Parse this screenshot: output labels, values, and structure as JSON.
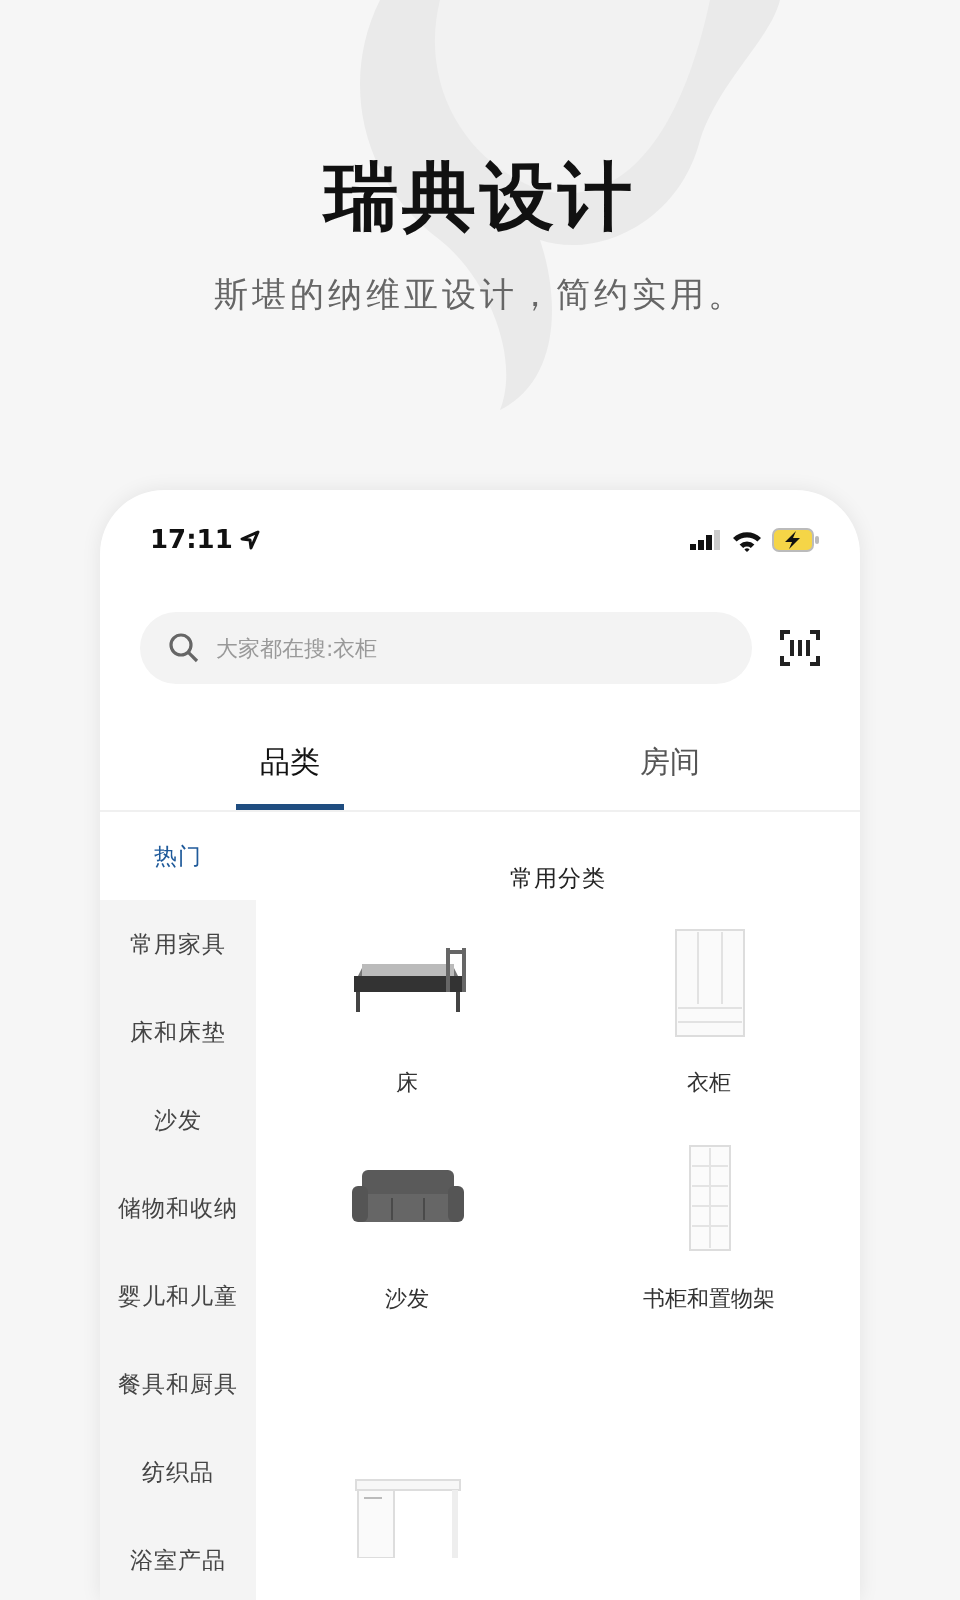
{
  "promo": {
    "title": "瑞典设计",
    "subtitle": "斯堪的纳维亚设计，简约实用。"
  },
  "status_bar": {
    "time": "17:11"
  },
  "search": {
    "placeholder": "大家都在搜:衣柜"
  },
  "tabs": [
    {
      "label": "品类",
      "selected": true
    },
    {
      "label": "房间",
      "selected": false
    }
  ],
  "sidebar": {
    "items": [
      {
        "label": "热门",
        "selected": true
      },
      {
        "label": "常用家具",
        "selected": false
      },
      {
        "label": "床和床垫",
        "selected": false
      },
      {
        "label": "沙发",
        "selected": false
      },
      {
        "label": "储物和收纳",
        "selected": false
      },
      {
        "label": "婴儿和儿童",
        "selected": false
      },
      {
        "label": "餐具和厨具",
        "selected": false
      },
      {
        "label": "纺织品",
        "selected": false
      },
      {
        "label": "浴室产品",
        "selected": false
      }
    ]
  },
  "sections": [
    {
      "title": "常用分类",
      "products": [
        {
          "kind": "bed",
          "label": "床"
        },
        {
          "kind": "wardrobe",
          "label": "衣柜"
        },
        {
          "kind": "sofa",
          "label": "沙发"
        },
        {
          "kind": "bookcase",
          "label": "书柜和置物架"
        }
      ]
    },
    {
      "products": [
        {
          "kind": "desk"
        }
      ]
    }
  ]
}
